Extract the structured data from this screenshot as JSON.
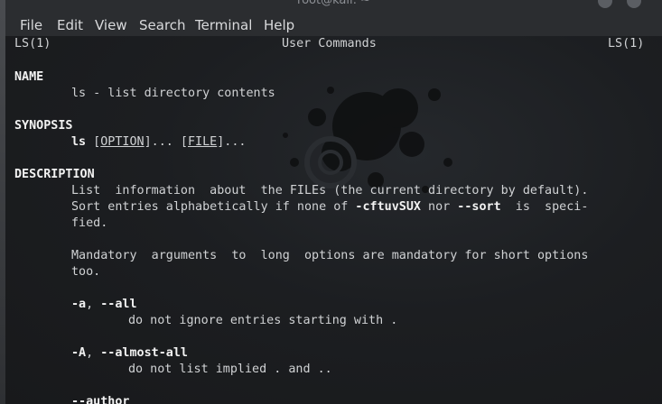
{
  "window": {
    "title": "root@kali: ~"
  },
  "menu": [
    "File",
    "Edit",
    "View",
    "Search",
    "Terminal",
    "Help"
  ],
  "man": {
    "header_left": "LS(1)",
    "header_center": "User Commands",
    "header_right": "LS(1)",
    "name_heading": "NAME",
    "name_text": "ls - list directory contents",
    "synopsis_heading": "SYNOPSIS",
    "synopsis_cmd": "ls",
    "synopsis_open1": " [",
    "synopsis_option": "OPTION",
    "synopsis_mid": "]... [",
    "synopsis_file": "FILE",
    "synopsis_close": "]...",
    "description_heading": "DESCRIPTION",
    "desc_line1": "List  information  about  the FILEs (the current directory by default).",
    "desc_line2_a": "Sort entries alphabetically if none of ",
    "desc_line2_flag1": "-cftuvSUX",
    "desc_line2_b": " nor ",
    "desc_line2_flag2": "--sort",
    "desc_line2_c": "  is  speci-",
    "desc_line3": "fied.",
    "desc_line4": "Mandatory  arguments  to  long  options are mandatory for short options",
    "desc_line5": "too.",
    "opt_a_short": "-a",
    "opt_sep": ", ",
    "opt_a_long": "--all",
    "opt_a_desc": "do not ignore entries starting with .",
    "opt_A_short": "-A",
    "opt_A_long": "--almost-all",
    "opt_A_desc": "do not list implied . and ..",
    "opt_author": "--author"
  }
}
